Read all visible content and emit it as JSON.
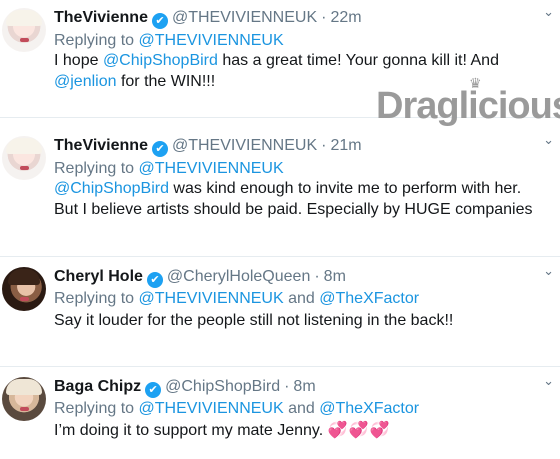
{
  "watermark": {
    "text": "Draglicious"
  },
  "tweets": [
    {
      "name": "TheVivienne",
      "handle": "@THEVIVIENNEUK",
      "time": "22m",
      "reply_prefix": "Replying to ",
      "reply_to_1": "@THEVIVIENNEUK",
      "reply_and": "",
      "reply_to_2": "",
      "body_1": "I hope ",
      "mention_1": "@ChipShopBird",
      "body_2": " has a great time! Your gonna kill it! And ",
      "mention_2": "@jenlion",
      "body_3": " for the WIN!!!"
    },
    {
      "name": "TheVivienne",
      "handle": "@THEVIVIENNEUK",
      "time": "21m",
      "reply_prefix": "Replying to ",
      "reply_to_1": "@THEVIVIENNEUK",
      "reply_and": "",
      "reply_to_2": "",
      "mention_1": "@ChipShopBird",
      "body_1": " was kind enough to invite me to perform with her. But I believe artists should be paid. Especially by HUGE companies"
    },
    {
      "name": "Cheryl Hole",
      "handle": "@CherylHoleQueen",
      "time": "8m",
      "reply_prefix": "Replying to ",
      "reply_to_1": "@THEVIVIENNEUK",
      "reply_and": " and ",
      "reply_to_2": "@TheXFactor",
      "body_1": "Say it louder for the people still not listening in the back!!"
    },
    {
      "name": "Baga Chipz",
      "handle": "@ChipShopBird",
      "time": "8m",
      "reply_prefix": "Replying to ",
      "reply_to_1": "@THEVIVIENNEUK",
      "reply_and": " and ",
      "reply_to_2": "@TheXFactor",
      "body_1": "I’m doing it to support my mate Jenny. ",
      "hearts": "💞💞💞"
    }
  ],
  "icons": {
    "verified": "✔",
    "caret": "⌄",
    "dot": "·"
  },
  "colors": {
    "link": "#1b95e0",
    "muted": "#657786",
    "verified": "#1da1f2",
    "divider": "#e6ecf0"
  }
}
